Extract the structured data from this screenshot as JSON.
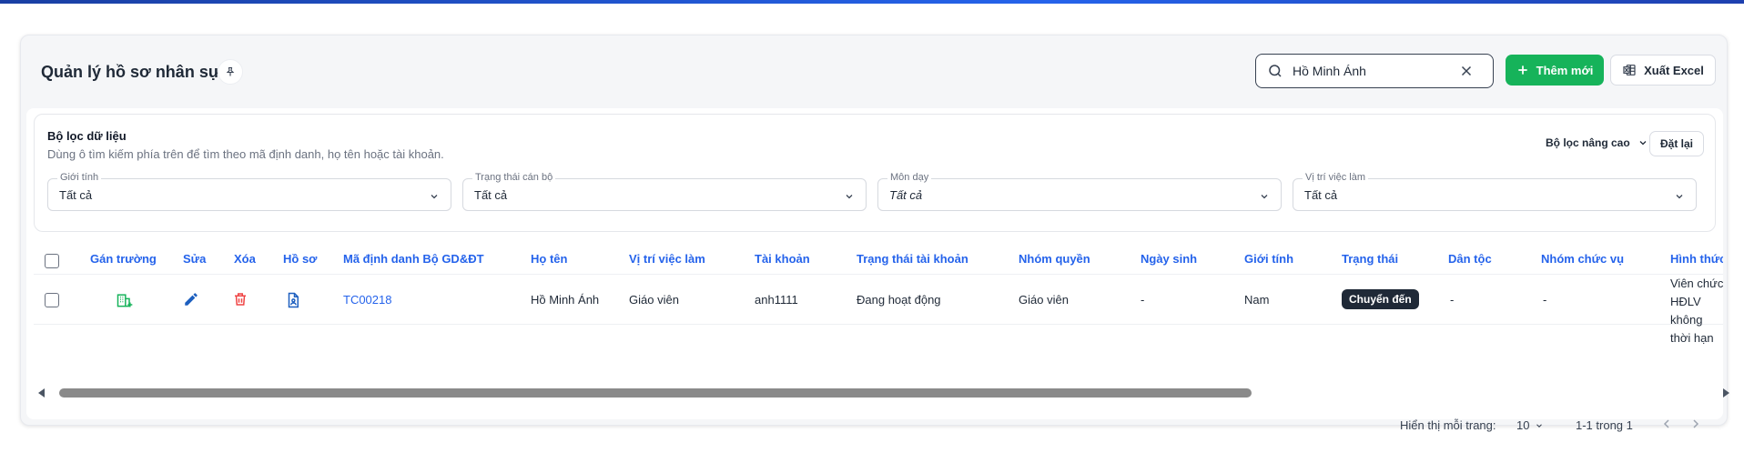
{
  "header": {
    "title": "Quản lý hồ sơ nhân sự",
    "search_value": "Hồ Minh Ánh",
    "add_label": "Thêm mới",
    "export_label": "Xuất Excel"
  },
  "filters": {
    "title": "Bộ lọc dữ liệu",
    "hint": "Dùng ô tìm kiếm phía trên để tìm theo mã định danh, họ tên hoặc tài khoản.",
    "advanced_label": "Bộ lọc nâng cao",
    "reset_label": "Đặt lại",
    "fields": [
      {
        "label": "Giới tính",
        "value": "Tất cả"
      },
      {
        "label": "Trạng thái cán bộ",
        "value": "Tất cả"
      },
      {
        "label": "Môn dạy",
        "value": "Tất cả"
      },
      {
        "label": "Vị trí việc làm",
        "value": "Tất cả"
      }
    ]
  },
  "table": {
    "columns": [
      "Gán trường",
      "Sửa",
      "Xóa",
      "Hồ sơ",
      "Mã định danh Bộ GD&ĐT",
      "Họ tên",
      "Vị trí việc làm",
      "Tài khoản",
      "Trạng thái tài khoản",
      "Nhóm quyền",
      "Ngày sinh",
      "Giới tính",
      "Trạng thái",
      "Dân tộc",
      "Nhóm chức vụ",
      "Hình thức"
    ],
    "rows": [
      {
        "ma_dinh_danh": "TC00218",
        "ho_ten": "Hồ Minh Ánh",
        "vi_tri": "Giáo viên",
        "tai_khoan": "anh1111",
        "trang_thai_tk": "Đang hoạt động",
        "nhom_quyen": "Giáo viên",
        "ngay_sinh": "-",
        "gioi_tinh": "Nam",
        "trang_thai": "Chuyển đến",
        "dan_toc": "-",
        "nhom_chuc_vu": "-",
        "hinh_thuc_1": "Viên chức",
        "hinh_thuc_2": "HĐLV không",
        "hinh_thuc_3": "thời hạn"
      }
    ]
  },
  "pagination": {
    "per_page_label": "Hiển thị mỗi trang:",
    "per_page_value": "10",
    "range_label": "1-1 trong 1"
  },
  "colors": {
    "primary": "#2563eb",
    "success": "#16b35a",
    "danger": "#ef4444",
    "dark": "#1f2937"
  }
}
